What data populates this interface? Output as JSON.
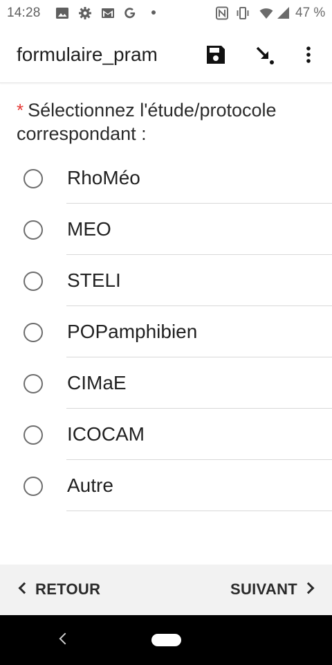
{
  "status_bar": {
    "time": "14:28",
    "battery_text": "47 %",
    "left_icons": [
      "image-icon",
      "gear-icon",
      "gmail-icon",
      "google-icon",
      "dot-icon"
    ],
    "right_icons": [
      "nfc-icon",
      "vibrate-icon",
      "wifi-icon",
      "signal-icon",
      "battery-icon"
    ]
  },
  "app_bar": {
    "title": "formulaire_pram",
    "actions": [
      "save-icon",
      "jump-arrow-icon",
      "more-vert-icon"
    ]
  },
  "question": {
    "required_marker": "*",
    "text": "Sélectionnez l'étude/protocole correspondant :"
  },
  "options": [
    {
      "label": "RhoMéo",
      "selected": false
    },
    {
      "label": "MEO",
      "selected": false
    },
    {
      "label": "STELI",
      "selected": false
    },
    {
      "label": "POPamphibien",
      "selected": false
    },
    {
      "label": "CIMaE",
      "selected": false
    },
    {
      "label": "ICOCAM",
      "selected": false
    },
    {
      "label": "Autre",
      "selected": false
    }
  ],
  "nav": {
    "back_label": "RETOUR",
    "next_label": "SUIVANT"
  },
  "colors": {
    "required": "#e53935",
    "bottom_bar": "#f2f2f2",
    "system_nav": "#000000"
  }
}
